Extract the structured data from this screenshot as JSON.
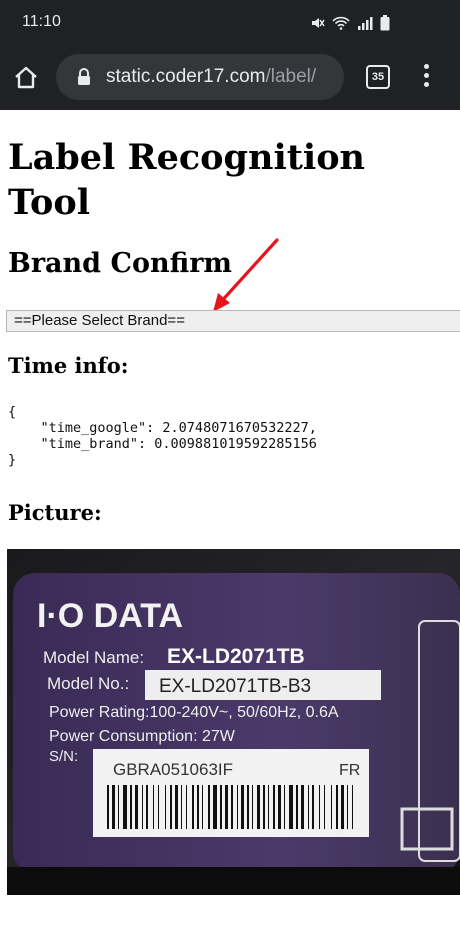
{
  "status_bar": {
    "time": "11:10"
  },
  "browser": {
    "url_host": "static.coder17.com",
    "url_path": "/label/",
    "tab_count": "35"
  },
  "page": {
    "title": "Label Recognition Tool",
    "brand_heading": "Brand Confirm",
    "brand_select_value": "==Please Select Brand==",
    "time_heading": "Time info:",
    "time_info_json": "{\n    \"time_google\": 2.0748071670532227,\n    \"time_brand\": 0.009881019592285156\n}",
    "picture_heading": "Picture:"
  },
  "picture": {
    "brand": "I·O DATA",
    "model_name_label": "Model Name:",
    "model_name": "EX-LD2071TB",
    "model_no_label": "Model No.:",
    "model_no": "EX-LD2071TB-B3",
    "power_rating": "Power Rating:100-240V~, 50/60Hz, 0.6A",
    "power_consumption": "Power Consumption: 27W",
    "sn_label": "S/N:",
    "serial": "GBRA051063IF",
    "region": "FR"
  },
  "colors": {
    "browser_chrome": "#202124",
    "url_bar": "#35363a",
    "annotation_arrow": "#e8141c"
  }
}
